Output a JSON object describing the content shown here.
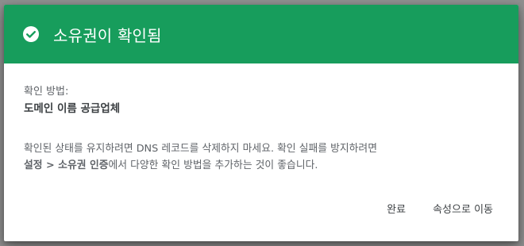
{
  "dialog": {
    "title": "소유권이 확인됨",
    "header_color": "#179d5c",
    "method_label": "확인 방법:",
    "method_value": "도메인 이름 공급업체",
    "description_line1": "확인된 상태를 유지하려면 DNS 레코드를 삭제하지 마세요. 확인 실패를 방지하려면",
    "description_bold": "설정 > 소유권 인증",
    "description_line2": "에서 다양한 확인 방법을 추가하는 것이 좋습니다.",
    "buttons": {
      "done": "완료",
      "go_to_property": "속성으로 이동"
    },
    "icons": {
      "header": "check-circle-icon"
    }
  }
}
